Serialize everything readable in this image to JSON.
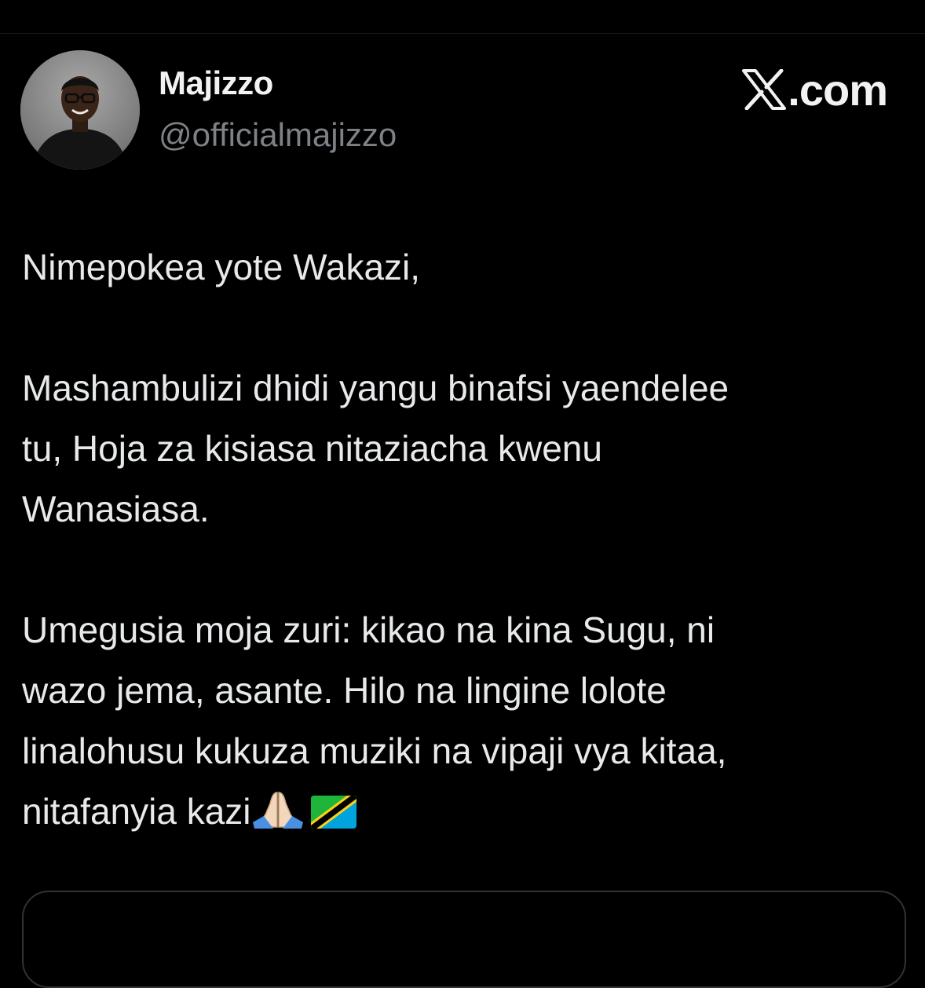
{
  "tweet": {
    "author": {
      "display_name": "Majizzo",
      "handle": "@officialmajizzo",
      "avatar": "profile-photo"
    },
    "brand": {
      "icon": "x-logo-icon",
      "text": ".com"
    },
    "paragraphs": [
      {
        "lines": [
          "Nimepokea yote Wakazi,"
        ]
      },
      {
        "lines": [
          "Mashambulizi dhidi yangu binafsi yaendelee",
          "tu, Hoja za kisiasa nitaziacha kwenu",
          "Wanasiasa."
        ]
      },
      {
        "lines": [
          "Umegusia moja zuri: kikao na kina Sugu, ni",
          "wazo jema, asante. Hilo na lingine lolote",
          "linalohusu kukuza muziki na vipaji vya kitaa,"
        ]
      }
    ],
    "last_line": "nitafanyia kazi",
    "emojis": [
      "folded-hands-icon",
      "tanzania-flag-icon"
    ]
  },
  "colors": {
    "background": "#000000",
    "text": "#e7e9ea",
    "handle": "#7d8287",
    "border": "#2f3336",
    "flag_green": "#1eb53a",
    "flag_blue": "#00a3dd",
    "flag_yellow": "#fcd116"
  }
}
